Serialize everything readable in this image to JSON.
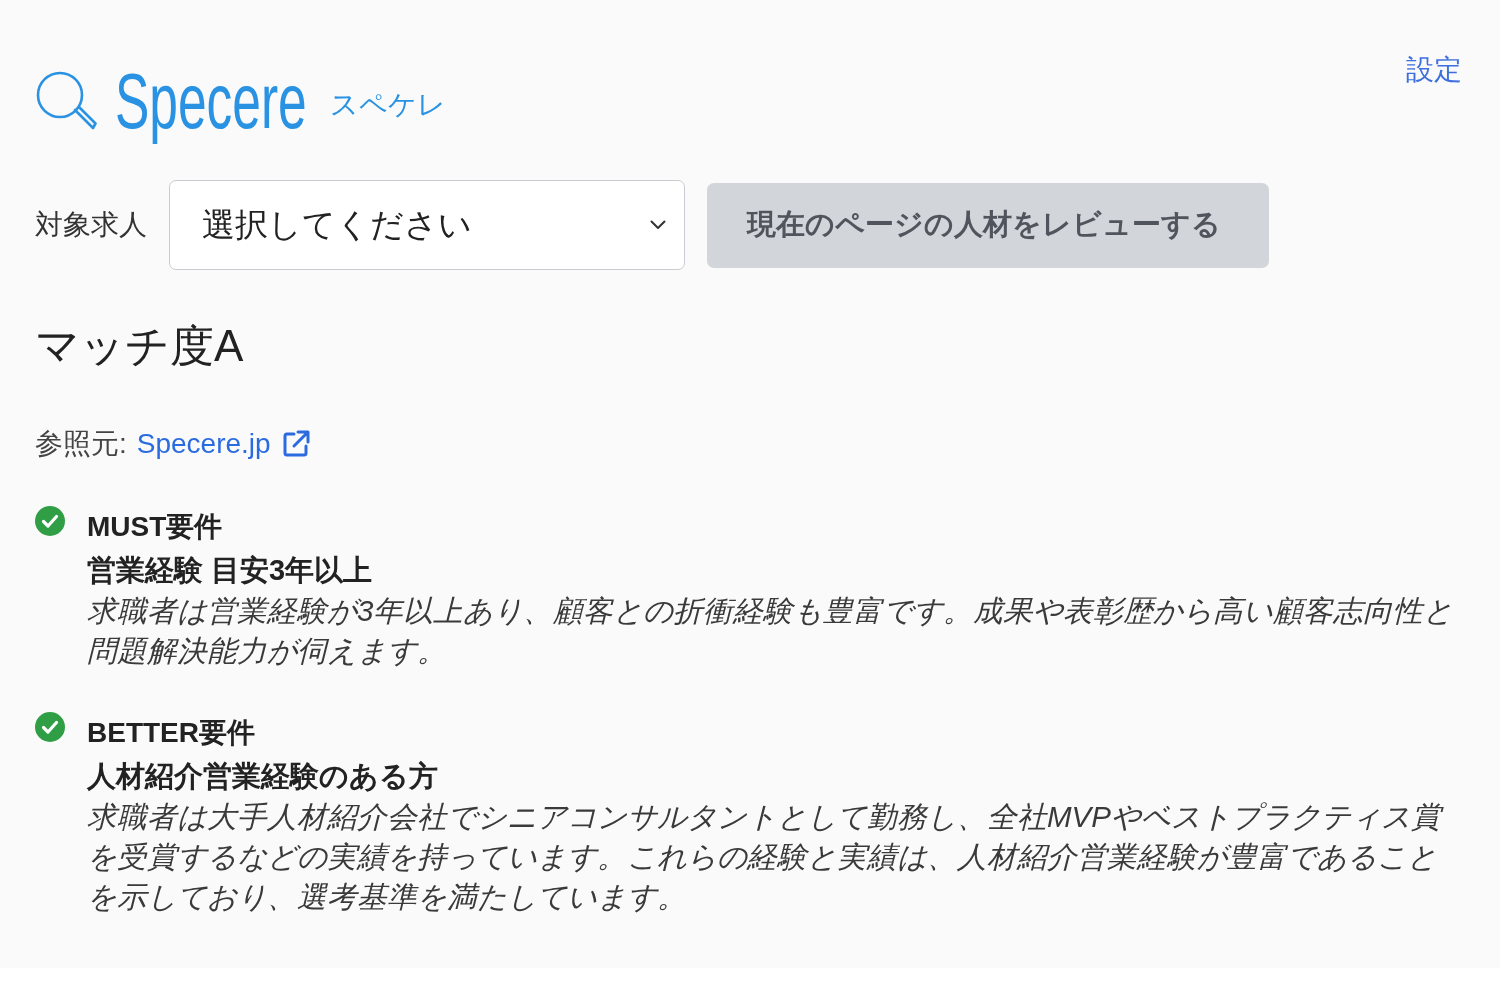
{
  "header": {
    "logo": "Specere",
    "logo_kana": "スペケレ",
    "settings_link": "設定"
  },
  "job_select": {
    "label": "対象求人",
    "placeholder": "選択してください"
  },
  "review_button": {
    "label": "現在のページの人材をレビューする",
    "disabled": true
  },
  "match_grade": "マッチ度A",
  "source": {
    "label": "参照元:",
    "link": "Specere.jp"
  },
  "requirements": [
    {
      "title": "MUST要件",
      "requirement": "営業経験 目安3年以上",
      "assessment": "求職者は営業経験が3年以上あり、顧客との折衝経験も豊富です。成果や表彰歴から高い顧客志向性と問題解決能力が伺えます。",
      "met": true
    },
    {
      "title": "BETTER要件",
      "requirement": "人材紹介営業経験のある方",
      "assessment": "求職者は大手人材紹介会社でシニアコンサルタントとして勤務し、全社MVPやベストプラクティス賞を受賞するなどの実績を持っています。これらの経験と実績は、人材紹介営業経験が豊富であることを示しており、選考基準を満たしています。",
      "met": true
    }
  ]
}
